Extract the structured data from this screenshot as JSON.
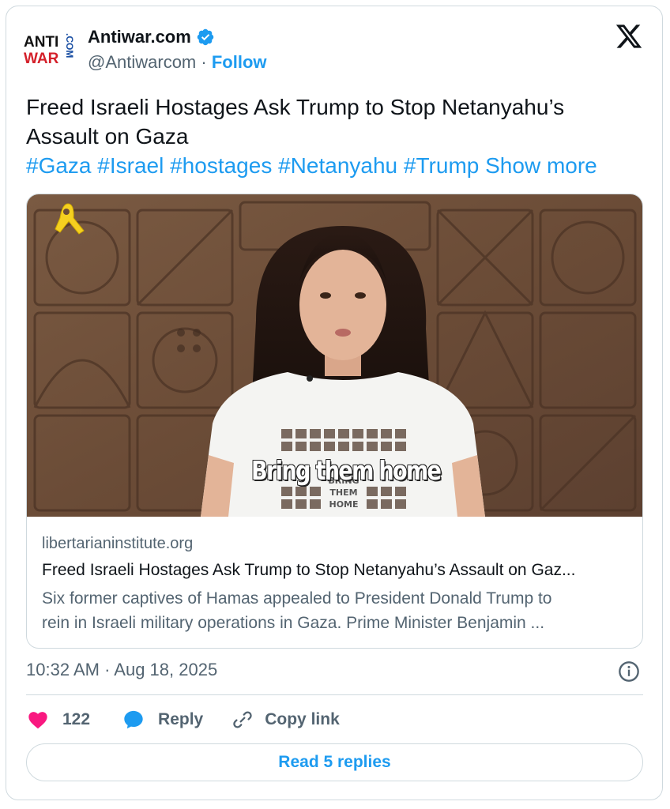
{
  "author": {
    "logo_text_top": "ANTI",
    "logo_text_bottom": "WAR",
    "logo_text_side": ".COM",
    "name": "Antiwar.com",
    "handle": "@Antiwarcom",
    "separator": "·",
    "follow_label": "Follow"
  },
  "tweet": {
    "text_line1": "Freed Israeli Hostages Ask Trump to Stop Netanyahu’s",
    "text_line2": "Assault on Gaza",
    "hashtags": [
      "#Gaza",
      "#Israel",
      "#hostages",
      "#Netanyahu",
      "#Trump"
    ],
    "show_more_label": "Show more"
  },
  "link_card": {
    "video_caption": "Bring them home",
    "shirt_text": [
      "BRING",
      "THEM",
      "HOME"
    ],
    "domain": "libertarianinstitute.org",
    "title": "Freed Israeli Hostages Ask Trump to Stop Netanyahu’s Assault on Gaz...",
    "description_line1": "Six former captives of Hamas appealed to President Donald Trump to",
    "description_line2": "rein in Israeli military operations in Gaza. Prime Minister Benjamin ..."
  },
  "meta": {
    "timestamp": "10:32 AM · Aug 18, 2025"
  },
  "actions": {
    "like_count": "122",
    "reply_label": "Reply",
    "copy_link_label": "Copy link"
  },
  "read_replies_label": "Read 5 replies",
  "colors": {
    "accent": "#1d9bf0",
    "like": "#f91880",
    "text": "#0f1419",
    "secondary": "#536471",
    "border": "#cfd9de"
  },
  "icons": [
    "verified-badge-icon",
    "x-logo-icon",
    "yellow-ribbon-icon",
    "info-icon",
    "heart-icon",
    "reply-bubble-icon",
    "link-icon"
  ]
}
